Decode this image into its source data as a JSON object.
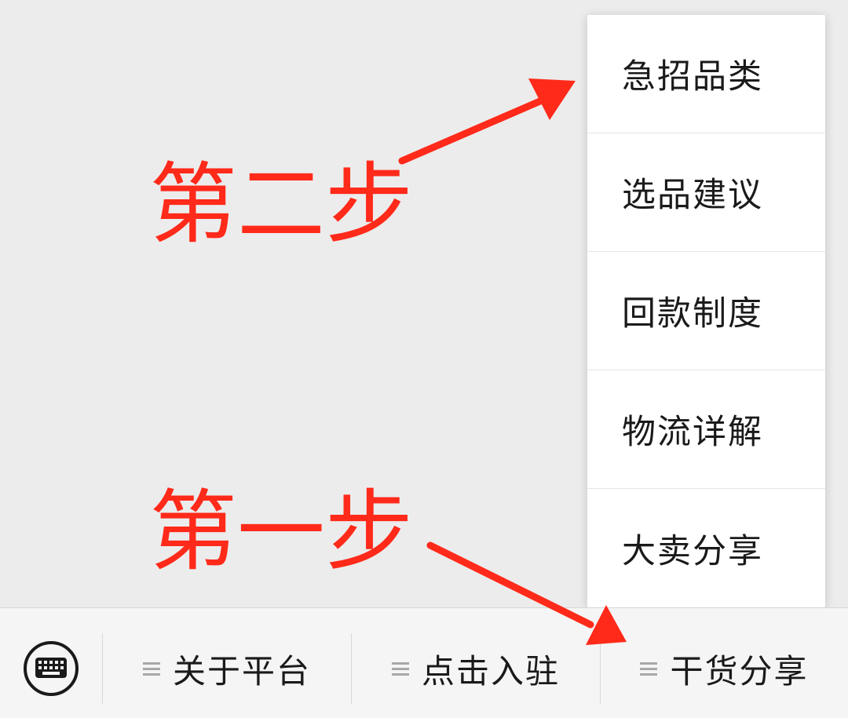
{
  "popup_menu": {
    "items": [
      {
        "label": "急招品类"
      },
      {
        "label": "选品建议"
      },
      {
        "label": "回款制度"
      },
      {
        "label": "物流详解"
      },
      {
        "label": "大卖分享"
      }
    ]
  },
  "bottom_menu": {
    "keyboard_icon": "keyboard-icon",
    "tabs": [
      {
        "label": "关于平台",
        "icon": "menu-lines-icon"
      },
      {
        "label": "点击入驻",
        "icon": "menu-lines-icon"
      },
      {
        "label": "干货分享",
        "icon": "menu-lines-icon"
      }
    ]
  },
  "annotations": {
    "step_two": "第二步",
    "step_one": "第一步",
    "color": "#ff2a1a"
  },
  "colors": {
    "chat_background": "#ececec",
    "bar_background": "#f5f5f5",
    "popup_background": "#ffffff"
  }
}
